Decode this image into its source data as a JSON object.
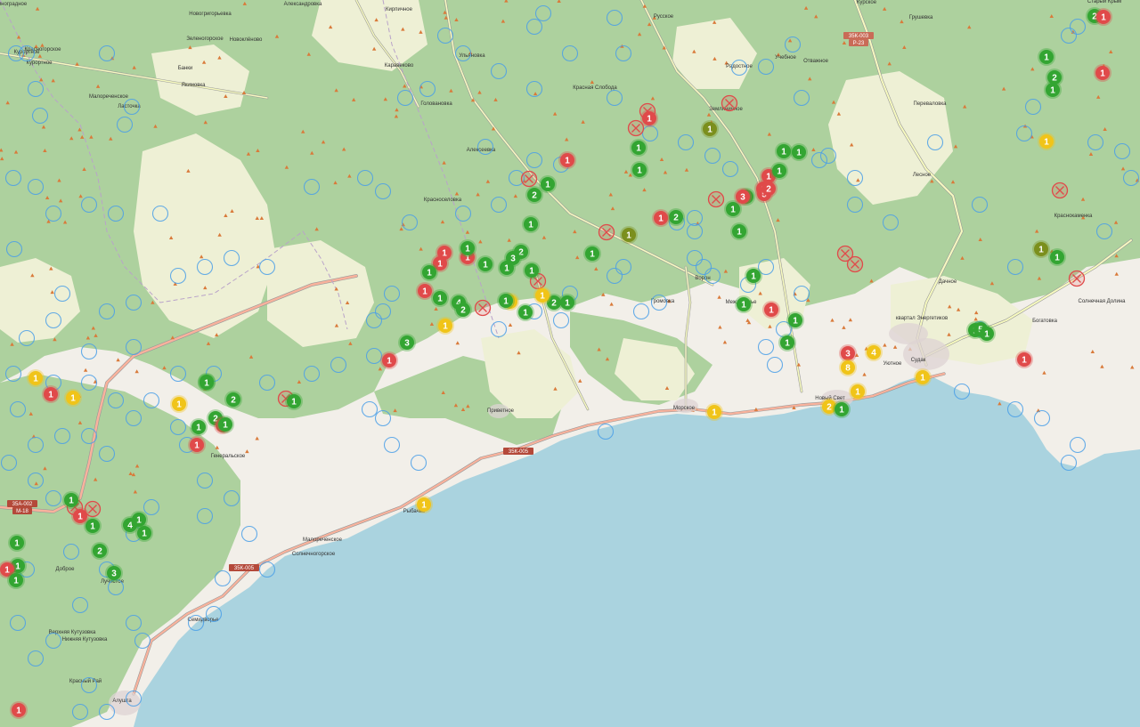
{
  "map": {
    "colors": {
      "sea": "#aad3df",
      "land": "#f2efe9",
      "forest": "#add19e",
      "field": "#eef0d5",
      "road": "#f7fabf",
      "trunk": "#f9b29c",
      "status_green": "#33a532",
      "status_red": "#e04a4a",
      "status_yellow": "#f0c419",
      "status_olive": "#7b8f1d",
      "empty_circle": "#4a9fe8"
    },
    "places": [
      {
        "name": "Новогригорьевка"
      },
      {
        "name": "Александровка"
      },
      {
        "name": "Кирпичное"
      },
      {
        "name": "Курортное"
      },
      {
        "name": "Ульяновка"
      },
      {
        "name": "Русское"
      },
      {
        "name": "Курское"
      },
      {
        "name": "Грушевка"
      },
      {
        "name": "Старый Крым"
      },
      {
        "name": "Виноградное"
      },
      {
        "name": "Зеленогорское"
      },
      {
        "name": "Новоклёново"
      },
      {
        "name": "Красногорское"
      },
      {
        "name": "Курортное"
      },
      {
        "name": "Банки"
      },
      {
        "name": "Ласточка"
      },
      {
        "name": "Якимовка"
      },
      {
        "name": "Каравеково"
      },
      {
        "name": "Радостное"
      },
      {
        "name": "Учебное"
      },
      {
        "name": "Отважное"
      },
      {
        "name": "Головановка"
      },
      {
        "name": "Красная Слобода"
      },
      {
        "name": "Переваловка"
      },
      {
        "name": "Малореченское"
      },
      {
        "name": "Земляничное"
      },
      {
        "name": "Алексеевка"
      },
      {
        "name": "Красноселовка"
      },
      {
        "name": "Лесное"
      },
      {
        "name": "Краснокаменка"
      },
      {
        "name": "Ворон"
      },
      {
        "name": "Громовка"
      },
      {
        "name": "Междуречье"
      },
      {
        "name": "Дачное"
      },
      {
        "name": "квартал Энергетиков"
      },
      {
        "name": "Солнечная Долина"
      },
      {
        "name": "Богатовка"
      },
      {
        "name": "Приветное"
      },
      {
        "name": "Морское"
      },
      {
        "name": "Судак"
      },
      {
        "name": "Новый Свет"
      },
      {
        "name": "Уютное"
      },
      {
        "name": "Рыбачье"
      },
      {
        "name": "Малореченское"
      },
      {
        "name": "Солнечногорское"
      },
      {
        "name": "Генеральское"
      },
      {
        "name": "Верхняя Кутузовка"
      },
      {
        "name": "Нижняя Кутузовка"
      },
      {
        "name": "Лучистое"
      },
      {
        "name": "Красный Рай"
      },
      {
        "name": "Алушта"
      },
      {
        "name": "Семидворье"
      },
      {
        "name": "Доброе"
      }
    ],
    "roads": [
      "35К-003",
      "Р-23",
      "35К-005",
      "35К-005",
      "35А-002",
      "М-18"
    ],
    "markers": [
      {
        "s": "green",
        "n": "1"
      },
      {
        "s": "green",
        "n": "2"
      },
      {
        "s": "red",
        "n": "1"
      },
      {
        "s": "green",
        "n": "2"
      },
      {
        "s": "green",
        "n": "1"
      },
      {
        "s": "red",
        "n": "1"
      },
      {
        "s": "yellow",
        "n": "1"
      },
      {
        "s": "red",
        "n": "1"
      },
      {
        "s": "green",
        "n": "1"
      },
      {
        "s": "red",
        "n": "1"
      },
      {
        "s": "green",
        "n": "1"
      },
      {
        "s": "olive",
        "n": "1"
      },
      {
        "s": "green",
        "n": "1"
      },
      {
        "s": "red",
        "n": "1"
      },
      {
        "s": "green",
        "n": "1"
      },
      {
        "s": "green",
        "n": "1"
      },
      {
        "s": "green",
        "n": "1"
      },
      {
        "s": "red",
        "n": "1"
      },
      {
        "s": "red",
        "n": "5"
      },
      {
        "s": "red",
        "n": "2"
      },
      {
        "s": "green",
        "n": "1"
      },
      {
        "s": "green",
        "n": "2"
      },
      {
        "s": "red",
        "n": "1"
      },
      {
        "s": "green",
        "n": "2"
      },
      {
        "s": "olive",
        "n": "1"
      },
      {
        "s": "green",
        "n": "1"
      },
      {
        "s": "green",
        "n": "1"
      },
      {
        "s": "green",
        "n": "1"
      },
      {
        "s": "red",
        "n": "1"
      },
      {
        "s": "red",
        "n": "1"
      },
      {
        "s": "green",
        "n": "1"
      },
      {
        "s": "green",
        "n": "1"
      },
      {
        "s": "green",
        "n": "1"
      },
      {
        "s": "green",
        "n": "2"
      },
      {
        "s": "red",
        "n": "1"
      },
      {
        "s": "green",
        "n": "3"
      },
      {
        "s": "red",
        "n": "1"
      },
      {
        "s": "green",
        "n": "1"
      },
      {
        "s": "green",
        "n": "4"
      },
      {
        "s": "green",
        "n": "2"
      },
      {
        "s": "yellow",
        "n": "2"
      },
      {
        "s": "green",
        "n": "1"
      },
      {
        "s": "green",
        "n": "2"
      },
      {
        "s": "green",
        "n": "1"
      },
      {
        "s": "yellow",
        "n": "1"
      },
      {
        "s": "red",
        "n": "1"
      },
      {
        "s": "green",
        "n": "3"
      },
      {
        "s": "red",
        "n": "1"
      },
      {
        "s": "green",
        "n": "1"
      },
      {
        "s": "green",
        "n": "1"
      },
      {
        "s": "red",
        "n": "3"
      },
      {
        "s": "green",
        "n": "1"
      },
      {
        "s": "green",
        "n": "1"
      },
      {
        "s": "red",
        "n": "3"
      },
      {
        "s": "yellow",
        "n": "4"
      },
      {
        "s": "yellow",
        "n": "8"
      },
      {
        "s": "yellow",
        "n": "1"
      },
      {
        "s": "yellow",
        "n": "2"
      },
      {
        "s": "green",
        "n": "1"
      },
      {
        "s": "yellow",
        "n": "1"
      },
      {
        "s": "green",
        "n": "1"
      },
      {
        "s": "green",
        "n": "5"
      },
      {
        "s": "green",
        "n": "1"
      },
      {
        "s": "red",
        "n": "1"
      },
      {
        "s": "olive",
        "n": "1"
      },
      {
        "s": "green",
        "n": "1"
      },
      {
        "s": "green",
        "n": "1"
      },
      {
        "s": "green",
        "n": "2"
      },
      {
        "s": "green",
        "n": "1"
      },
      {
        "s": "red",
        "n": "1"
      },
      {
        "s": "yellow",
        "n": "1"
      },
      {
        "s": "green",
        "n": "2"
      },
      {
        "s": "red",
        "n": "1"
      },
      {
        "s": "yellow",
        "n": "1"
      },
      {
        "s": "red",
        "n": "1"
      },
      {
        "s": "yellow",
        "n": "1"
      },
      {
        "s": "yellow",
        "n": "1"
      },
      {
        "s": "green",
        "n": "1"
      },
      {
        "s": "green",
        "n": "4"
      },
      {
        "s": "green",
        "n": "1"
      },
      {
        "s": "green",
        "n": "2"
      },
      {
        "s": "green",
        "n": "1"
      },
      {
        "s": "red",
        "n": "1"
      },
      {
        "s": "green",
        "n": "1"
      },
      {
        "s": "green",
        "n": "1"
      },
      {
        "s": "green",
        "n": "1"
      },
      {
        "s": "red",
        "n": "1"
      },
      {
        "s": "green",
        "n": "1"
      },
      {
        "s": "green",
        "n": "3"
      },
      {
        "s": "green",
        "n": "1"
      },
      {
        "s": "yellow",
        "n": "1"
      },
      {
        "s": "green",
        "n": "1"
      },
      {
        "s": "green",
        "n": "1"
      },
      {
        "s": "red",
        "n": "1"
      },
      {
        "s": "green",
        "n": "1"
      },
      {
        "s": "green",
        "n": "1"
      },
      {
        "s": "green",
        "n": "1"
      },
      {
        "s": "green",
        "n": "1"
      },
      {
        "s": "yellow",
        "n": "1"
      }
    ]
  }
}
